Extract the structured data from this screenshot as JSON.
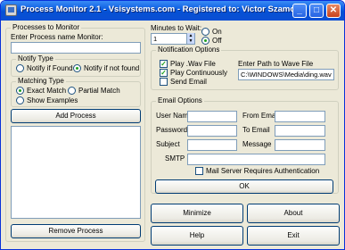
{
  "window": {
    "title": "Process Monitor 2.1 - Vsisystems.com - Registered to: Victor Szamody",
    "min_glyph": "_",
    "max_glyph": "□",
    "close_glyph": "✕"
  },
  "processes": {
    "legend": "Processes to Monitor",
    "enter_label": "Enter Process name Monitor:",
    "name_value": "",
    "notify": {
      "legend": "Notify Type",
      "options": [
        "Notify if Found",
        "Notify if not found"
      ],
      "selected": "Notify if not found"
    },
    "matching": {
      "legend": "Matching Type",
      "options": [
        "Exact Match",
        "Partial Match",
        "Show Examples"
      ],
      "selected": "Exact Match"
    },
    "add_label": "Add Process",
    "list_items": [],
    "remove_label": "Remove Process"
  },
  "wait": {
    "label": "Minutes to Wait:",
    "value": "1",
    "options": [
      "On",
      "Off"
    ],
    "selected": "Off"
  },
  "notification": {
    "legend": "Notification Options",
    "play_wav": {
      "label": "Play .Wav File",
      "checked": true
    },
    "play_cont": {
      "label": "Play Continuously",
      "checked": true
    },
    "send_email": {
      "label": "Send Email",
      "checked": false
    },
    "path_label": "Enter Path to Wave File",
    "path_value": "C:\\WINDOWS\\Media\\ding.wav"
  },
  "email": {
    "legend": "Email Options",
    "user_label": "User Name",
    "password_label": "Password",
    "subject_label": "Subject",
    "smtp_label": "SMTP",
    "from_label": "From Email",
    "to_label": "To Email",
    "message_label": "Message",
    "auth_label": "Mail Server Requires Authentication",
    "auth_checked": false,
    "ok_label": "OK"
  },
  "buttons": {
    "minimize": "Minimize",
    "about": "About",
    "help": "Help",
    "exit": "Exit"
  }
}
